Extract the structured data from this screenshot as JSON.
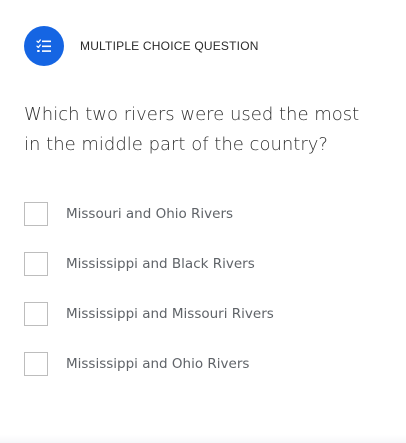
{
  "header": {
    "label": "MULTIPLE CHOICE QUESTION",
    "badge_icon": "checklist-icon",
    "badge_color": "#1565e3"
  },
  "question": {
    "text": "Which two rivers were used the most in the middle part of the country?"
  },
  "options": [
    {
      "label": "Missouri and Ohio Rivers",
      "checked": false
    },
    {
      "label": "Mississippi and Black Rivers",
      "checked": false
    },
    {
      "label": "Mississippi and Missouri Rivers",
      "checked": false
    },
    {
      "label": "Mississippi and Ohio Rivers",
      "checked": false
    }
  ]
}
